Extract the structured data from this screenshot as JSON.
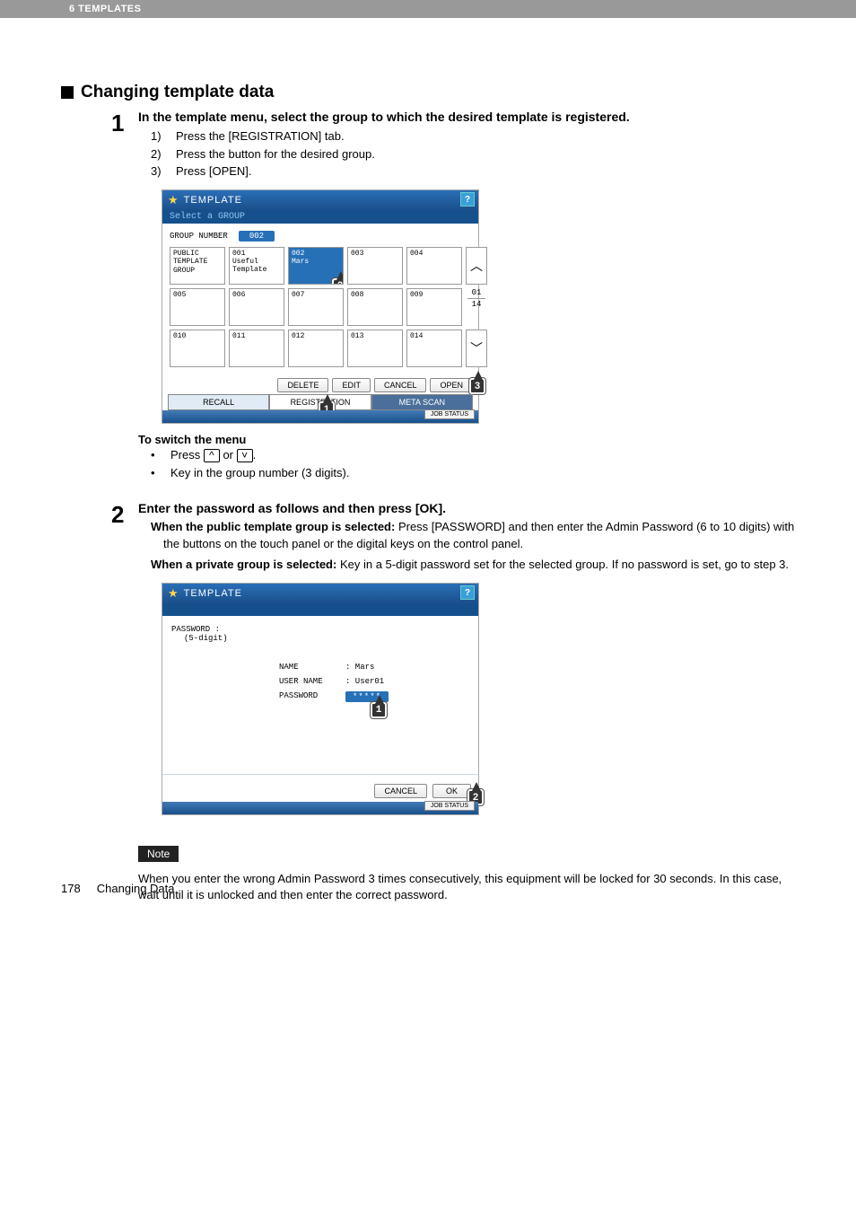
{
  "header": {
    "chapter": "6 TEMPLATES"
  },
  "section": {
    "title": "Changing template data"
  },
  "step1": {
    "num": "1",
    "title": "In the template menu, select the group to which the desired template is registered.",
    "sub1_n": "1)",
    "sub1_t": "Press the [REGISTRATION] tab.",
    "sub2_n": "2)",
    "sub2_t": "Press the button for the desired group.",
    "sub3_n": "3)",
    "sub3_t": "Press [OPEN].",
    "switch_title": "To switch the menu",
    "b1_pre": "Press ",
    "b1_or": " or ",
    "b1_post": ".",
    "b2": "Key in the group number (3 digits)."
  },
  "step2": {
    "num": "2",
    "title": "Enter the password as follows and then press [OK].",
    "public_bold": "When the public template group is selected: ",
    "public_rest": "Press [PASSWORD] and then enter the Admin Password (6 to 10 digits) with the buttons on the touch panel or the digital keys on the control panel.",
    "private_bold": "When a private group is selected: ",
    "private_rest": "Key in a 5-digit password set for the selected group. If no password is set, go to step 3."
  },
  "note": {
    "label": "Note",
    "text": "When you enter the wrong Admin Password 3 times consecutively, this equipment will be locked for 30 seconds. In this case, wait until it is unlocked and then enter the correct password."
  },
  "footer": {
    "page": "178",
    "label": "Changing Data"
  },
  "scr1": {
    "title": "TEMPLATE",
    "subtitle": "Select a GROUP",
    "group_number_label": "GROUP NUMBER",
    "group_number_value": "002",
    "cells": {
      "public": "PUBLIC TEMPLATE GROUP",
      "c001_num": "001",
      "c001_name": "Useful Template",
      "c002_num": "002",
      "c002_name": "Mars",
      "c003": "003",
      "c004": "004",
      "c005": "005",
      "c006": "006",
      "c007": "007",
      "c008": "008",
      "c009": "009",
      "c010": "010",
      "c011": "011",
      "c012": "012",
      "c013": "013",
      "c014": "014"
    },
    "pager_top": "01",
    "pager_bot": "14",
    "btn_delete": "DELETE",
    "btn_edit": "EDIT",
    "btn_cancel": "CANCEL",
    "btn_open": "OPEN",
    "tab_recall": "RECALL",
    "tab_registration": "REGISTRATION",
    "tab_meta": "META SCAN",
    "job_status": "JOB STATUS",
    "callout1": "1",
    "callout2": "2",
    "callout3": "3"
  },
  "scr2": {
    "title": "TEMPLATE",
    "pw_label1": "PASSWORD :",
    "pw_label2": "(5-digit)",
    "name_k": "NAME",
    "name_v": ": Mars",
    "user_k": "USER NAME",
    "user_v": ": User01",
    "pass_k": "PASSWORD",
    "pass_v": "*****",
    "btn_cancel": "CANCEL",
    "btn_ok": "OK",
    "job_status": "JOB STATUS",
    "callout1": "1",
    "callout2": "2"
  }
}
